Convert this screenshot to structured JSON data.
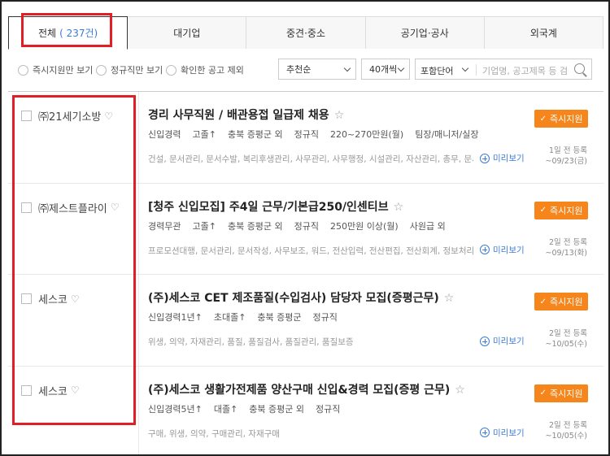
{
  "tabs": [
    {
      "label": "전체",
      "count": "( 237건)"
    },
    {
      "label": "대기업"
    },
    {
      "label": "중견·중소"
    },
    {
      "label": "공기업·공사"
    },
    {
      "label": "외국계"
    }
  ],
  "filters": {
    "radio_apply": "즉시지원만 보기",
    "radio_regular": "정규직만 보기",
    "radio_exclude": "확인한 공고 제외",
    "sort": "추천순",
    "per_page": "40개씩",
    "search_scope": "포함단어",
    "search_placeholder": "기업명, 공고제목 등 검색"
  },
  "apply_label": "즉시지원",
  "preview_label": "미리보기",
  "jobs": [
    {
      "company": "㈜21세기소방",
      "title": "경리 사무직원 / 배관용접 일급제 채용",
      "meta": [
        "신입경력",
        "고졸↑",
        "충북 증평군 외",
        "정규직",
        "220~270만원(월)",
        "팀장/매니저/실장"
      ],
      "tags": "건설, 문서관리, 문서수발, 복리후생관리, 사무관리, 사무행정, 시설관리, 자산관리, 총무, 문서관리, ...",
      "date1": "1일 전 등록",
      "date2": "~09/23(금)"
    },
    {
      "company": "㈜제스트플라이",
      "title": "[청주 신입모집] 주4일 근무/기본급250/인센티브",
      "meta": [
        "경력무관",
        "고졸↑",
        "충북 증평군 외",
        "정규직",
        "250만원 이상(월)",
        "사원급 외"
      ],
      "tags": "프로모션대행, 문서관리, 문서작성, 사무보조, 워드, 전산입력, 전산편집, 전산회계, 정보처리, 정보...",
      "date1": "2일 전 등록",
      "date2": "~09/13(화)"
    },
    {
      "company": "세스코",
      "title": "(주)세스코 CET 제조품질(수입검사) 담당자 모집(증평근무)",
      "meta": [
        "신입경력1년↑",
        "초대졸↑",
        "충북 증평군",
        "정규직"
      ],
      "tags": "위생, 의약, 자재관리, 품질, 품질검사, 품질관리, 품질보증",
      "date1": "2일 전 등록",
      "date2": "~10/05(수)"
    },
    {
      "company": "세스코",
      "title": "(주)세스코 생활가전제품 양산구매 신입&경력 모집(증평 근무)",
      "meta": [
        "신입경력5년↑",
        "대졸↑",
        "충북 증평군 외",
        "정규직"
      ],
      "tags": "구매, 위생, 의약, 구매관리, 자재구매",
      "date1": "2일 전 등록",
      "date2": "~10/05(수)"
    }
  ]
}
